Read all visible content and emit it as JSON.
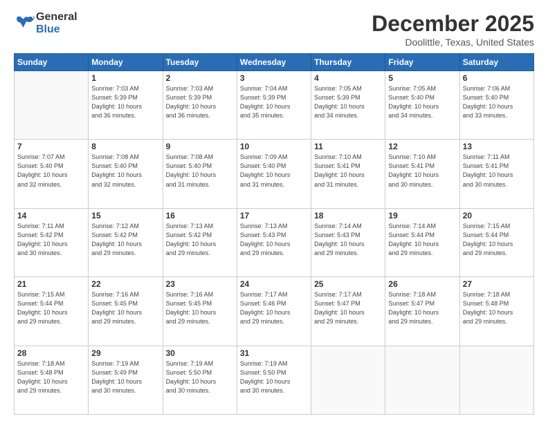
{
  "header": {
    "logo_general": "General",
    "logo_blue": "Blue",
    "month_title": "December 2025",
    "location": "Doolittle, Texas, United States"
  },
  "calendar": {
    "days_of_week": [
      "Sunday",
      "Monday",
      "Tuesday",
      "Wednesday",
      "Thursday",
      "Friday",
      "Saturday"
    ],
    "weeks": [
      [
        {
          "day": "",
          "info": ""
        },
        {
          "day": "1",
          "info": "Sunrise: 7:03 AM\nSunset: 5:39 PM\nDaylight: 10 hours\nand 36 minutes."
        },
        {
          "day": "2",
          "info": "Sunrise: 7:03 AM\nSunset: 5:39 PM\nDaylight: 10 hours\nand 36 minutes."
        },
        {
          "day": "3",
          "info": "Sunrise: 7:04 AM\nSunset: 5:39 PM\nDaylight: 10 hours\nand 35 minutes."
        },
        {
          "day": "4",
          "info": "Sunrise: 7:05 AM\nSunset: 5:39 PM\nDaylight: 10 hours\nand 34 minutes."
        },
        {
          "day": "5",
          "info": "Sunrise: 7:05 AM\nSunset: 5:40 PM\nDaylight: 10 hours\nand 34 minutes."
        },
        {
          "day": "6",
          "info": "Sunrise: 7:06 AM\nSunset: 5:40 PM\nDaylight: 10 hours\nand 33 minutes."
        }
      ],
      [
        {
          "day": "7",
          "info": "Sunrise: 7:07 AM\nSunset: 5:40 PM\nDaylight: 10 hours\nand 32 minutes."
        },
        {
          "day": "8",
          "info": "Sunrise: 7:08 AM\nSunset: 5:40 PM\nDaylight: 10 hours\nand 32 minutes."
        },
        {
          "day": "9",
          "info": "Sunrise: 7:08 AM\nSunset: 5:40 PM\nDaylight: 10 hours\nand 31 minutes."
        },
        {
          "day": "10",
          "info": "Sunrise: 7:09 AM\nSunset: 5:40 PM\nDaylight: 10 hours\nand 31 minutes."
        },
        {
          "day": "11",
          "info": "Sunrise: 7:10 AM\nSunset: 5:41 PM\nDaylight: 10 hours\nand 31 minutes."
        },
        {
          "day": "12",
          "info": "Sunrise: 7:10 AM\nSunset: 5:41 PM\nDaylight: 10 hours\nand 30 minutes."
        },
        {
          "day": "13",
          "info": "Sunrise: 7:11 AM\nSunset: 5:41 PM\nDaylight: 10 hours\nand 30 minutes."
        }
      ],
      [
        {
          "day": "14",
          "info": "Sunrise: 7:11 AM\nSunset: 5:42 PM\nDaylight: 10 hours\nand 30 minutes."
        },
        {
          "day": "15",
          "info": "Sunrise: 7:12 AM\nSunset: 5:42 PM\nDaylight: 10 hours\nand 29 minutes."
        },
        {
          "day": "16",
          "info": "Sunrise: 7:13 AM\nSunset: 5:42 PM\nDaylight: 10 hours\nand 29 minutes."
        },
        {
          "day": "17",
          "info": "Sunrise: 7:13 AM\nSunset: 5:43 PM\nDaylight: 10 hours\nand 29 minutes."
        },
        {
          "day": "18",
          "info": "Sunrise: 7:14 AM\nSunset: 5:43 PM\nDaylight: 10 hours\nand 29 minutes."
        },
        {
          "day": "19",
          "info": "Sunrise: 7:14 AM\nSunset: 5:44 PM\nDaylight: 10 hours\nand 29 minutes."
        },
        {
          "day": "20",
          "info": "Sunrise: 7:15 AM\nSunset: 5:44 PM\nDaylight: 10 hours\nand 29 minutes."
        }
      ],
      [
        {
          "day": "21",
          "info": "Sunrise: 7:15 AM\nSunset: 5:44 PM\nDaylight: 10 hours\nand 29 minutes."
        },
        {
          "day": "22",
          "info": "Sunrise: 7:16 AM\nSunset: 5:45 PM\nDaylight: 10 hours\nand 29 minutes."
        },
        {
          "day": "23",
          "info": "Sunrise: 7:16 AM\nSunset: 5:45 PM\nDaylight: 10 hours\nand 29 minutes."
        },
        {
          "day": "24",
          "info": "Sunrise: 7:17 AM\nSunset: 5:46 PM\nDaylight: 10 hours\nand 29 minutes."
        },
        {
          "day": "25",
          "info": "Sunrise: 7:17 AM\nSunset: 5:47 PM\nDaylight: 10 hours\nand 29 minutes."
        },
        {
          "day": "26",
          "info": "Sunrise: 7:18 AM\nSunset: 5:47 PM\nDaylight: 10 hours\nand 29 minutes."
        },
        {
          "day": "27",
          "info": "Sunrise: 7:18 AM\nSunset: 5:48 PM\nDaylight: 10 hours\nand 29 minutes."
        }
      ],
      [
        {
          "day": "28",
          "info": "Sunrise: 7:18 AM\nSunset: 5:48 PM\nDaylight: 10 hours\nand 29 minutes."
        },
        {
          "day": "29",
          "info": "Sunrise: 7:19 AM\nSunset: 5:49 PM\nDaylight: 10 hours\nand 30 minutes."
        },
        {
          "day": "30",
          "info": "Sunrise: 7:19 AM\nSunset: 5:50 PM\nDaylight: 10 hours\nand 30 minutes."
        },
        {
          "day": "31",
          "info": "Sunrise: 7:19 AM\nSunset: 5:50 PM\nDaylight: 10 hours\nand 30 minutes."
        },
        {
          "day": "",
          "info": ""
        },
        {
          "day": "",
          "info": ""
        },
        {
          "day": "",
          "info": ""
        }
      ]
    ]
  }
}
